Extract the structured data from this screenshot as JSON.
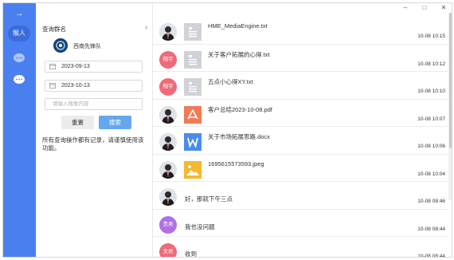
{
  "rail": {
    "user_label": "猴人"
  },
  "filter": {
    "title": "查询群名",
    "group_name": "西南先锋队",
    "start_date": "2023-09-13",
    "end_date": "2023-10-13",
    "search_placeholder": "请输入搜索内容",
    "reset_label": "重置",
    "search_label": "搜索",
    "notice": "所有查询操作都有记录，请谨慎使用该功能。"
  },
  "messages": [
    {
      "avatar": "photo",
      "avatar_label": "",
      "file": "doc",
      "text": "HME_MediaEngine.txt",
      "time": "10-08 10:15"
    },
    {
      "avatar": "text",
      "avatar_label": "翔宇",
      "avatar_color": "#f06a7a",
      "file": "doc",
      "text": "关于客户拓展的心得.txt",
      "time": "10-08 10:12"
    },
    {
      "avatar": "text",
      "avatar_label": "翔宇",
      "avatar_color": "#f06a7a",
      "file": "doc",
      "text": "五点小心得XY.txt",
      "time": "10-08 10:10"
    },
    {
      "avatar": "photo",
      "avatar_label": "",
      "file": "pdf",
      "text": "客户总结2023-10-08.pdf",
      "time": "10-08 10:07"
    },
    {
      "avatar": "photo",
      "avatar_label": "",
      "file": "word",
      "text": "关于市场拓展思路.docx",
      "time": "10-08 10:06"
    },
    {
      "avatar": "photo",
      "avatar_label": "",
      "file": "image",
      "text": "1695615573593.jpeg",
      "time": "10-08 10:04"
    },
    {
      "avatar": "photo",
      "avatar_label": "",
      "file": "none",
      "text": "好，那就下午三点",
      "time": "10-08 08:46"
    },
    {
      "avatar": "text",
      "avatar_label": "贵男",
      "avatar_color": "#b070e8",
      "file": "none",
      "text": "我也没问题",
      "time": "10-08 08:44"
    },
    {
      "avatar": "text",
      "avatar_label": "文君",
      "avatar_color": "#f06a7a",
      "file": "none",
      "text": "收到",
      "time": "10-08 08:44"
    }
  ]
}
